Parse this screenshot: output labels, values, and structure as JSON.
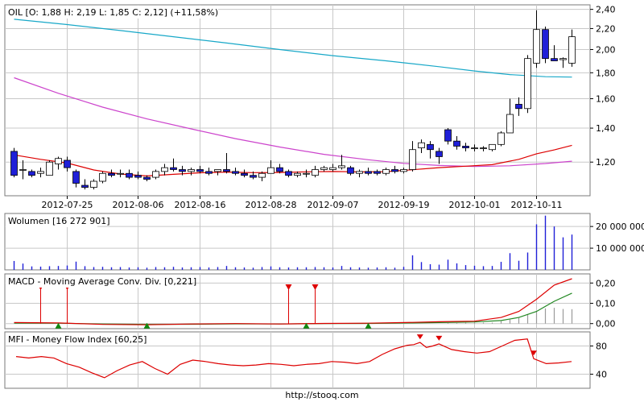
{
  "chart_data": [
    {
      "type": "candlestick",
      "title": "OIL [O: 1,88  H: 2,19  L: 1,85  C: 2,12] (+11,58%)",
      "y_ticks": [
        "2,40",
        "2,20",
        "2,00",
        "1,80",
        "1,60",
        "1,40",
        "1,20"
      ],
      "y_tick_values": [
        2.4,
        2.2,
        2.0,
        1.8,
        1.6,
        1.4,
        1.2
      ],
      "ylim": [
        1.03,
        2.45
      ],
      "log_scale": true,
      "x_ticks": [
        "2012-07-25",
        "2012-08-06",
        "2012-08-16",
        "2012-08-28",
        "2012-09-07",
        "2012-09-19",
        "2012-10-01",
        "2012-10-11"
      ],
      "x_tick_index": [
        6,
        14,
        21,
        29,
        36,
        44,
        52,
        59
      ],
      "grid": true,
      "up_color": "#ffffff",
      "down_color": "#1f1fd8",
      "candles": [
        [
          1.26,
          1.28,
          1.12,
          1.13
        ],
        [
          1.16,
          1.21,
          1.11,
          1.16
        ],
        [
          1.15,
          1.16,
          1.12,
          1.13
        ],
        [
          1.14,
          1.17,
          1.12,
          1.15
        ],
        [
          1.13,
          1.21,
          1.13,
          1.2
        ],
        [
          1.19,
          1.23,
          1.16,
          1.22
        ],
        [
          1.21,
          1.23,
          1.15,
          1.17
        ],
        [
          1.15,
          1.16,
          1.07,
          1.09
        ],
        [
          1.08,
          1.11,
          1.06,
          1.07
        ],
        [
          1.07,
          1.11,
          1.06,
          1.1
        ],
        [
          1.1,
          1.15,
          1.09,
          1.14
        ],
        [
          1.14,
          1.16,
          1.12,
          1.13
        ],
        [
          1.14,
          1.16,
          1.12,
          1.14
        ],
        [
          1.14,
          1.16,
          1.11,
          1.12
        ],
        [
          1.13,
          1.15,
          1.11,
          1.12
        ],
        [
          1.12,
          1.13,
          1.1,
          1.11
        ],
        [
          1.12,
          1.16,
          1.11,
          1.15
        ],
        [
          1.15,
          1.19,
          1.13,
          1.17
        ],
        [
          1.17,
          1.22,
          1.15,
          1.16
        ],
        [
          1.16,
          1.18,
          1.13,
          1.15
        ],
        [
          1.15,
          1.17,
          1.13,
          1.16
        ],
        [
          1.16,
          1.18,
          1.14,
          1.15
        ],
        [
          1.15,
          1.17,
          1.13,
          1.14
        ],
        [
          1.15,
          1.16,
          1.13,
          1.16
        ],
        [
          1.16,
          1.25,
          1.14,
          1.15
        ],
        [
          1.15,
          1.17,
          1.13,
          1.14
        ],
        [
          1.14,
          1.16,
          1.12,
          1.13
        ],
        [
          1.13,
          1.15,
          1.11,
          1.12
        ],
        [
          1.12,
          1.15,
          1.1,
          1.14
        ],
        [
          1.14,
          1.21,
          1.14,
          1.17
        ],
        [
          1.17,
          1.19,
          1.14,
          1.15
        ],
        [
          1.15,
          1.16,
          1.12,
          1.13
        ],
        [
          1.13,
          1.15,
          1.12,
          1.14
        ],
        [
          1.14,
          1.16,
          1.12,
          1.14
        ],
        [
          1.13,
          1.18,
          1.12,
          1.16
        ],
        [
          1.16,
          1.18,
          1.15,
          1.17
        ],
        [
          1.16,
          1.19,
          1.15,
          1.17
        ],
        [
          1.17,
          1.24,
          1.16,
          1.18
        ],
        [
          1.17,
          1.18,
          1.13,
          1.14
        ],
        [
          1.14,
          1.16,
          1.12,
          1.15
        ],
        [
          1.15,
          1.17,
          1.13,
          1.14
        ],
        [
          1.15,
          1.16,
          1.13,
          1.14
        ],
        [
          1.14,
          1.17,
          1.13,
          1.16
        ],
        [
          1.16,
          1.18,
          1.14,
          1.15
        ],
        [
          1.15,
          1.17,
          1.14,
          1.16
        ],
        [
          1.16,
          1.32,
          1.15,
          1.27
        ],
        [
          1.28,
          1.33,
          1.25,
          1.31
        ],
        [
          1.3,
          1.32,
          1.22,
          1.27
        ],
        [
          1.26,
          1.28,
          1.19,
          1.23
        ],
        [
          1.39,
          1.4,
          1.3,
          1.32
        ],
        [
          1.32,
          1.35,
          1.27,
          1.29
        ],
        [
          1.29,
          1.31,
          1.26,
          1.28
        ],
        [
          1.28,
          1.3,
          1.26,
          1.28
        ],
        [
          1.28,
          1.29,
          1.26,
          1.28
        ],
        [
          1.27,
          1.3,
          1.26,
          1.3
        ],
        [
          1.3,
          1.38,
          1.29,
          1.37
        ],
        [
          1.37,
          1.6,
          1.37,
          1.49
        ],
        [
          1.56,
          1.61,
          1.48,
          1.53
        ],
        [
          1.53,
          1.95,
          1.5,
          1.92
        ],
        [
          1.88,
          2.39,
          1.84,
          2.19
        ],
        [
          2.19,
          2.22,
          1.88,
          1.92
        ],
        [
          1.92,
          2.04,
          1.9,
          1.9
        ],
        [
          1.91,
          1.93,
          1.84,
          1.92
        ],
        [
          1.88,
          2.19,
          1.85,
          2.12
        ]
      ],
      "ma_short": {
        "color": "#dd0000",
        "points": [
          [
            0,
            1.24
          ],
          [
            3,
            1.215
          ],
          [
            6,
            1.195
          ],
          [
            9,
            1.158
          ],
          [
            12,
            1.137
          ],
          [
            15,
            1.127
          ],
          [
            18,
            1.135
          ],
          [
            21,
            1.143
          ],
          [
            24,
            1.147
          ],
          [
            27,
            1.144
          ],
          [
            30,
            1.145
          ],
          [
            33,
            1.148
          ],
          [
            36,
            1.15
          ],
          [
            39,
            1.148
          ],
          [
            42,
            1.149
          ],
          [
            45,
            1.159
          ],
          [
            48,
            1.17
          ],
          [
            51,
            1.178
          ],
          [
            54,
            1.186
          ],
          [
            57,
            1.215
          ],
          [
            59,
            1.246
          ],
          [
            61,
            1.268
          ],
          [
            63,
            1.295
          ]
        ]
      },
      "ma_mid": {
        "color": "#cc44cc",
        "points": [
          [
            0,
            1.76
          ],
          [
            5,
            1.64
          ],
          [
            10,
            1.54
          ],
          [
            15,
            1.46
          ],
          [
            20,
            1.395
          ],
          [
            25,
            1.335
          ],
          [
            30,
            1.285
          ],
          [
            35,
            1.243
          ],
          [
            40,
            1.213
          ],
          [
            44,
            1.193
          ],
          [
            48,
            1.182
          ],
          [
            52,
            1.176
          ],
          [
            56,
            1.18
          ],
          [
            60,
            1.192
          ],
          [
            63,
            1.205
          ]
        ]
      },
      "ma_long": {
        "color": "#18a8c8",
        "points": [
          [
            0,
            2.295
          ],
          [
            6,
            2.24
          ],
          [
            12,
            2.18
          ],
          [
            18,
            2.12
          ],
          [
            24,
            2.06
          ],
          [
            30,
            2.0
          ],
          [
            36,
            1.945
          ],
          [
            42,
            1.9
          ],
          [
            48,
            1.85
          ],
          [
            52,
            1.815
          ],
          [
            56,
            1.785
          ],
          [
            60,
            1.768
          ],
          [
            63,
            1.765
          ]
        ]
      }
    },
    {
      "type": "bar",
      "title": "Wolumen [16 272 901]",
      "y_ticks": [
        "20 000 000",
        "10 000 000"
      ],
      "y_tick_values": [
        20000000,
        10000000
      ],
      "ylim": [
        0,
        26000000
      ],
      "bar_color": "#1f1fd8",
      "values": [
        4100000,
        2900000,
        1600000,
        1500000,
        1700000,
        1800000,
        2000000,
        3800000,
        1700000,
        1300000,
        1400000,
        1200000,
        1300000,
        1100000,
        1200000,
        1000000,
        1300000,
        1200000,
        1400000,
        1100000,
        1200000,
        1300000,
        1100000,
        1300000,
        1800000,
        1200000,
        1100000,
        1000000,
        1300000,
        1600000,
        1200000,
        1100000,
        1200000,
        1200000,
        1300000,
        1200000,
        1100000,
        1800000,
        1200000,
        1100000,
        1000000,
        1100000,
        1200000,
        1000000,
        1400000,
        6700000,
        3600000,
        2600000,
        2400000,
        4700000,
        3000000,
        2200000,
        1900000,
        1700000,
        1800000,
        3700000,
        7700000,
        4200000,
        8000000,
        21000000,
        25000000,
        20000000,
        15000000,
        16272901
      ]
    },
    {
      "type": "line",
      "title": "MACD - Moving Average Conv. Div. [0,221]",
      "y_ticks": [
        "0,20",
        "0,10",
        "0,00"
      ],
      "y_tick_values": [
        0.2,
        0.1,
        0.0
      ],
      "ylim": [
        -0.025,
        0.245
      ],
      "series": [
        {
          "color": "#dd0000",
          "points": [
            [
              0,
              0.005
            ],
            [
              5,
              0.003
            ],
            [
              10,
              -0.004
            ],
            [
              15,
              -0.006
            ],
            [
              20,
              -0.002
            ],
            [
              25,
              0.0
            ],
            [
              30,
              -0.002
            ],
            [
              35,
              0.001
            ],
            [
              40,
              0.002
            ],
            [
              45,
              0.006
            ],
            [
              48,
              0.009
            ],
            [
              52,
              0.012
            ],
            [
              55,
              0.03
            ],
            [
              57,
              0.06
            ],
            [
              59,
              0.12
            ],
            [
              61,
              0.19
            ],
            [
              63,
              0.221
            ]
          ]
        },
        {
          "color": "#228822",
          "points": [
            [
              0,
              0.002
            ],
            [
              5,
              0.002
            ],
            [
              10,
              -0.002
            ],
            [
              15,
              -0.004
            ],
            [
              20,
              -0.003
            ],
            [
              25,
              -0.001
            ],
            [
              30,
              -0.002
            ],
            [
              35,
              0.0
            ],
            [
              40,
              0.001
            ],
            [
              45,
              0.003
            ],
            [
              48,
              0.005
            ],
            [
              52,
              0.008
            ],
            [
              55,
              0.015
            ],
            [
              57,
              0.03
            ],
            [
              59,
              0.06
            ],
            [
              61,
              0.11
            ],
            [
              63,
              0.15
            ]
          ]
        }
      ],
      "hist_color": "#9a9a9a",
      "histogram": [
        0,
        0,
        0,
        0,
        0,
        0,
        0,
        0,
        0,
        0,
        0,
        0,
        0,
        0,
        0,
        0,
        0,
        0,
        0,
        0,
        0,
        0,
        0,
        0,
        0,
        0,
        0,
        0,
        0,
        0,
        0,
        0,
        0,
        0,
        0,
        0,
        0,
        0,
        0,
        0,
        0,
        0,
        0,
        0,
        0,
        0,
        0,
        0,
        0,
        0.003,
        0.003,
        0.004,
        0.004,
        0.005,
        0.005,
        0.012,
        0.02,
        0.028,
        0.045,
        0.06,
        0.075,
        0.078,
        0.072,
        0.071
      ],
      "sell_markers": [
        3,
        6,
        31,
        34
      ],
      "buy_markers": [
        5,
        15,
        33,
        40
      ],
      "sell_color": "#dd0000",
      "buy_color": "#118811"
    },
    {
      "type": "line",
      "title": "MFI - Money Flow Index [60,25]",
      "y_ticks": [
        "80",
        "40"
      ],
      "y_tick_values": [
        80,
        40
      ],
      "ylim": [
        20,
        100
      ],
      "series": [
        {
          "color": "#dd0000",
          "points": [
            [
              0,
              65
            ],
            [
              2,
              63
            ],
            [
              4,
              65
            ],
            [
              6,
              63
            ],
            [
              8,
              55
            ],
            [
              10,
              50
            ],
            [
              12,
              42
            ],
            [
              14,
              35
            ],
            [
              16,
              45
            ],
            [
              18,
              53
            ],
            [
              20,
              58
            ],
            [
              22,
              48
            ],
            [
              24,
              40
            ],
            [
              26,
              54
            ],
            [
              28,
              60
            ],
            [
              30,
              58
            ],
            [
              32,
              55
            ],
            [
              34,
              53
            ],
            [
              36,
              52
            ],
            [
              38,
              53
            ],
            [
              40,
              55
            ],
            [
              42,
              54
            ],
            [
              44,
              52
            ],
            [
              46,
              54
            ],
            [
              48,
              55
            ],
            [
              50,
              58
            ],
            [
              52,
              57
            ],
            [
              54,
              55
            ],
            [
              56,
              58
            ],
            [
              58,
              68
            ],
            [
              60,
              76
            ],
            [
              62,
              81
            ],
            [
              63,
              82
            ],
            [
              64,
              85
            ],
            [
              65,
              78
            ],
            [
              66,
              80
            ],
            [
              67,
              83
            ],
            [
              69,
              75
            ],
            [
              71,
              72
            ],
            [
              73,
              70
            ],
            [
              75,
              72
            ],
            [
              77,
              80
            ],
            [
              79,
              88
            ],
            [
              81,
              90
            ],
            [
              82,
              62
            ],
            [
              84,
              55
            ],
            [
              86,
              56
            ],
            [
              88,
              58
            ]
          ]
        }
      ],
      "markers": [
        64,
        67,
        82
      ],
      "marker_color": "#dd0000"
    }
  ],
  "footer": {
    "url": "http://stooq.com"
  }
}
